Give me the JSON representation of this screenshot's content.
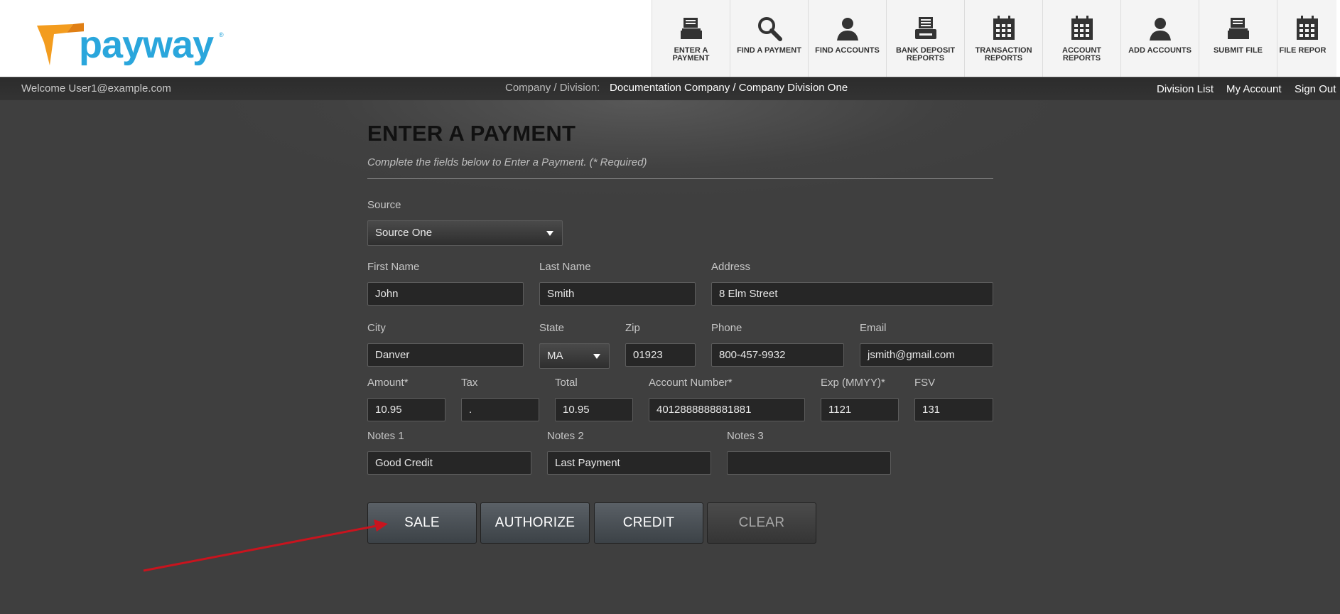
{
  "brand": {
    "logo_text": "payway",
    "registered_mark": "®",
    "colors": {
      "blue": "#2aa6dc",
      "orange": "#f39c1e",
      "arrow_red": "#c8141e"
    }
  },
  "nav": [
    {
      "label": "ENTER A PAYMENT",
      "icon": "cash-register-icon"
    },
    {
      "label": "FIND A PAYMENT",
      "icon": "magnifier-icon"
    },
    {
      "label": "FIND ACCOUNTS",
      "icon": "person-icon"
    },
    {
      "label": "BANK DEPOSIT REPORTS",
      "icon": "printer-icon"
    },
    {
      "label": "TRANSACTION REPORTS",
      "icon": "calendar-icon"
    },
    {
      "label": "ACCOUNT REPORTS",
      "icon": "calendar-icon"
    },
    {
      "label": "ADD ACCOUNTS",
      "icon": "person-icon"
    },
    {
      "label": "SUBMIT FILE",
      "icon": "cash-register-icon"
    },
    {
      "label": "FILE REPOR",
      "icon": "calendar-icon"
    }
  ],
  "subbar": {
    "welcome": "Welcome User1@example.com",
    "company_label": "Company / Division:",
    "company_value": "Documentation Company / Company Division One",
    "links": [
      "Division List",
      "My Account",
      "Sign Out"
    ]
  },
  "page": {
    "title": "ENTER A PAYMENT",
    "subtitle": "Complete the fields below to Enter a Payment. (* Required)"
  },
  "form": {
    "source": {
      "label": "Source",
      "value": "Source One"
    },
    "first_name": {
      "label": "First Name",
      "value": "John"
    },
    "last_name": {
      "label": "Last Name",
      "value": "Smith"
    },
    "address": {
      "label": "Address",
      "value": "8 Elm Street"
    },
    "city": {
      "label": "City",
      "value": "Danver"
    },
    "state": {
      "label": "State",
      "value": "MA"
    },
    "zip": {
      "label": "Zip",
      "value": "01923"
    },
    "phone": {
      "label": "Phone",
      "value": "800-457-9932"
    },
    "email": {
      "label": "Email",
      "value": "jsmith@gmail.com"
    },
    "amount": {
      "label": "Amount*",
      "value": "10.95"
    },
    "tax": {
      "label": "Tax",
      "value": "."
    },
    "total": {
      "label": "Total",
      "value": "10.95"
    },
    "account_number": {
      "label": "Account Number*",
      "value": "4012888888881881"
    },
    "exp": {
      "label": "Exp (MMYY)*",
      "value": "1121"
    },
    "fsv": {
      "label": "FSV",
      "value": "131"
    },
    "notes1": {
      "label": "Notes 1",
      "value": "Good Credit"
    },
    "notes2": {
      "label": "Notes 2",
      "value": "Last Payment"
    },
    "notes3": {
      "label": "Notes 3",
      "value": ""
    }
  },
  "buttons": {
    "sale": "SALE",
    "authorize": "AUTHORIZE",
    "credit": "CREDIT",
    "clear": "CLEAR"
  }
}
